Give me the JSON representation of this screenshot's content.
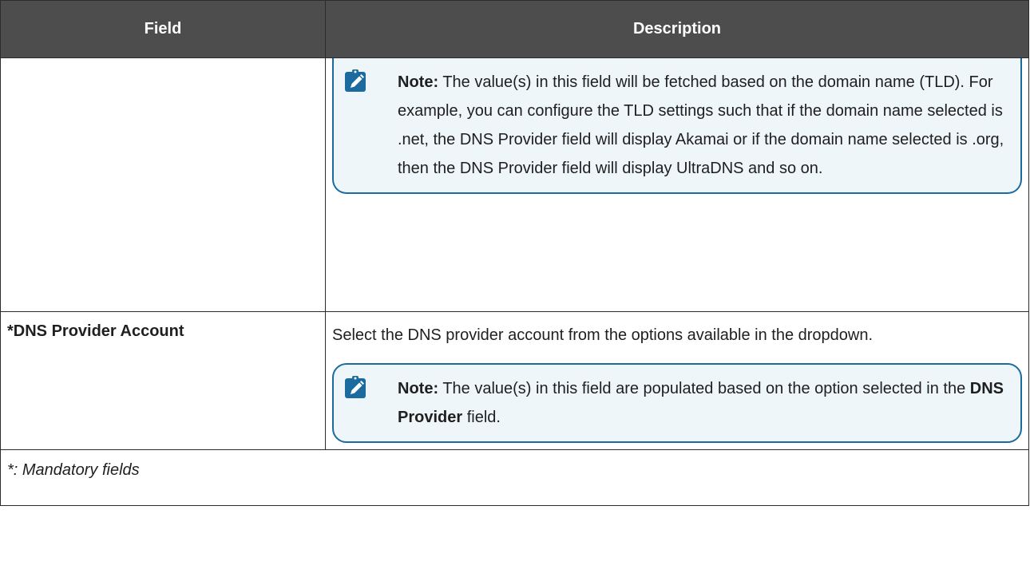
{
  "table": {
    "headers": {
      "field": "Field",
      "description": "Description"
    },
    "rows": [
      {
        "field": "",
        "note": {
          "label": "Note:",
          "text": "The value(s) in this field will be fetched based on the domain name (TLD). For example, you can configure the TLD settings such that if the domain name selected is .net, the DNS Provider field will display Akamai or if the domain name selected is .org, then the DNS Provider field will display UltraDNS and so on."
        }
      },
      {
        "field": "*DNS Provider Account",
        "description": "Select the DNS provider account from the options available in the dropdown.",
        "note": {
          "label": "Note:",
          "text_before": "The value(s) in this field are populated based on the option selected in the",
          "emphasis": "DNS Provider",
          "text_after": "field."
        }
      }
    ],
    "footer": "*: Mandatory fields"
  },
  "icons": {
    "note": "pencil-on-clipboard-icon"
  },
  "colors": {
    "header_bg": "#4d4d4d",
    "note_border": "#1c6b9e",
    "note_bg": "#eef6fa",
    "icon": "#1c6b9e"
  }
}
